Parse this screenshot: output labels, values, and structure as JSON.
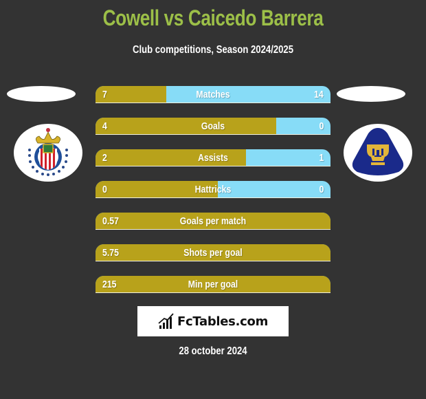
{
  "header": {
    "title": "Cowell vs Caicedo Barrera",
    "subtitle": "Club competitions, Season 2024/2025"
  },
  "players": {
    "left": {
      "name": "Cowell",
      "club_logo": "chivas-guadalajara-crest-icon"
    },
    "right": {
      "name": "Caicedo Barrera",
      "club_logo": "pumas-unam-crest-icon"
    }
  },
  "colors": {
    "title": "#9cbf48",
    "left_bar": "#b8a21b",
    "right_bar": "#87dcf7",
    "background": "#333333"
  },
  "stats": [
    {
      "label": "Matches",
      "left": "7",
      "right": "14",
      "left_share": 0.3
    },
    {
      "label": "Goals",
      "left": "4",
      "right": "0",
      "left_share": 0.77
    },
    {
      "label": "Assists",
      "left": "2",
      "right": "1",
      "left_share": 0.64
    },
    {
      "label": "Hattricks",
      "left": "0",
      "right": "0",
      "left_share": 0.52
    },
    {
      "label": "Goals per match",
      "left": "0.57",
      "right": "",
      "left_share": 1.0
    },
    {
      "label": "Shots per goal",
      "left": "5.75",
      "right": "",
      "left_share": 1.0
    },
    {
      "label": "Min per goal",
      "left": "215",
      "right": "",
      "left_share": 1.0
    }
  ],
  "brand": {
    "name": "FcTables.com",
    "icon": "bar-chart-icon"
  },
  "footer": {
    "date": "28 october 2024"
  }
}
